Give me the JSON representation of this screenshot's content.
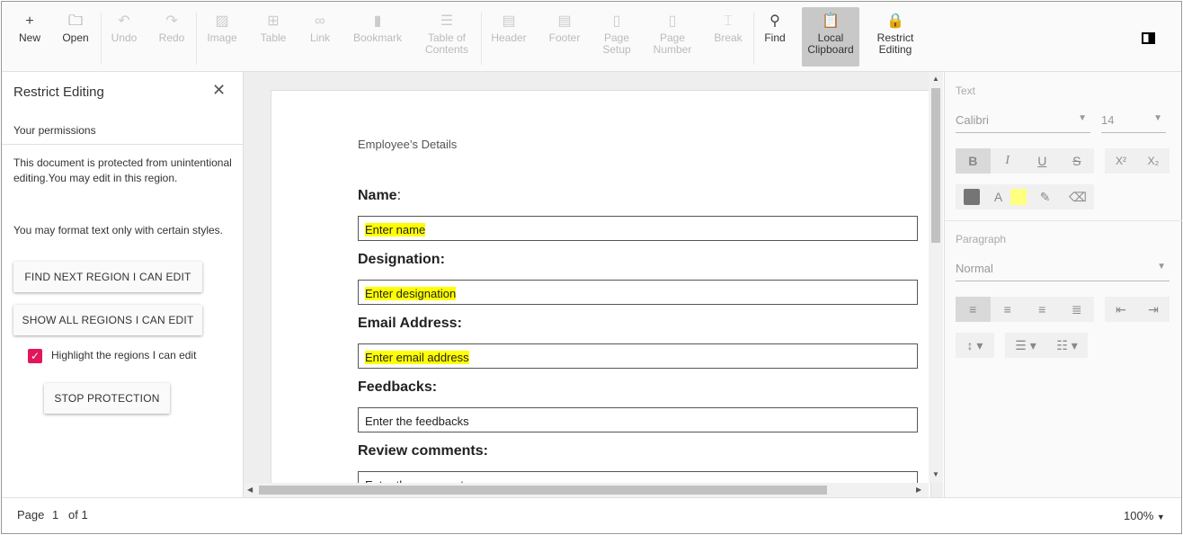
{
  "toolbar": {
    "items": [
      {
        "label": "New",
        "icon": "+",
        "state": "enabled"
      },
      {
        "label": "Open",
        "icon": "🗀",
        "state": "enabled"
      },
      {
        "label": "Undo",
        "icon": "↶",
        "state": "disabled"
      },
      {
        "label": "Redo",
        "icon": "↷",
        "state": "disabled"
      },
      {
        "label": "Image",
        "icon": "▨",
        "state": "disabled"
      },
      {
        "label": "Table",
        "icon": "⊞",
        "state": "disabled"
      },
      {
        "label": "Link",
        "icon": "∞",
        "state": "disabled"
      },
      {
        "label": "Bookmark",
        "icon": "▮",
        "state": "disabled"
      },
      {
        "label": "Table of Contents",
        "icon": "☰",
        "state": "disabled"
      },
      {
        "label": "Header",
        "icon": "▤",
        "state": "disabled"
      },
      {
        "label": "Footer",
        "icon": "▤",
        "state": "disabled"
      },
      {
        "label": "Page Setup",
        "icon": "▯",
        "state": "disabled"
      },
      {
        "label": "Page Number",
        "icon": "▯",
        "state": "disabled"
      },
      {
        "label": "Break",
        "icon": "⌶",
        "state": "disabled"
      },
      {
        "label": "Find",
        "icon": "⚲",
        "state": "enabled"
      },
      {
        "label": "Local Clipboard",
        "icon": "📋",
        "state": "active"
      },
      {
        "label": "Restrict Editing",
        "icon": "🔒",
        "state": "enabled"
      }
    ]
  },
  "left": {
    "title": "Restrict Editing",
    "permissions": "Your permissions",
    "para1": "This document is protected from unintentional editing.You may edit in this region.",
    "para2": "You may format text only with certain styles.",
    "find_next": "FIND NEXT REGION I CAN EDIT",
    "show_all": "SHOW ALL REGIONS I CAN EDIT",
    "highlight": "Highlight the regions I can edit",
    "highlight_checked": true,
    "stop": "STOP PROTECTION"
  },
  "doc": {
    "header": "Employee’s Details",
    "fields": [
      {
        "label": "Name",
        "colon": ":",
        "value": "Enter name",
        "highlighted": true
      },
      {
        "label": "Designation:",
        "colon": "",
        "value": "Enter designation",
        "highlighted": true
      },
      {
        "label": "Email Address:",
        "colon": "",
        "value": "Enter email address",
        "highlighted": true
      },
      {
        "label": "Feedbacks:",
        "colon": "",
        "value": "Enter the feedbacks",
        "highlighted": false
      },
      {
        "label": "Review comments:",
        "colon": "",
        "value": "Enter the comments",
        "highlighted": false
      }
    ]
  },
  "right": {
    "text_section": "Text",
    "font": "Calibri",
    "size": "14",
    "paragraph_section": "Paragraph",
    "style": "Normal",
    "font_color": "#757575",
    "highlight_color": "#ffff80"
  },
  "status": {
    "page_label": "Page",
    "page": "1",
    "of_label": "of 1",
    "zoom": "100%"
  }
}
